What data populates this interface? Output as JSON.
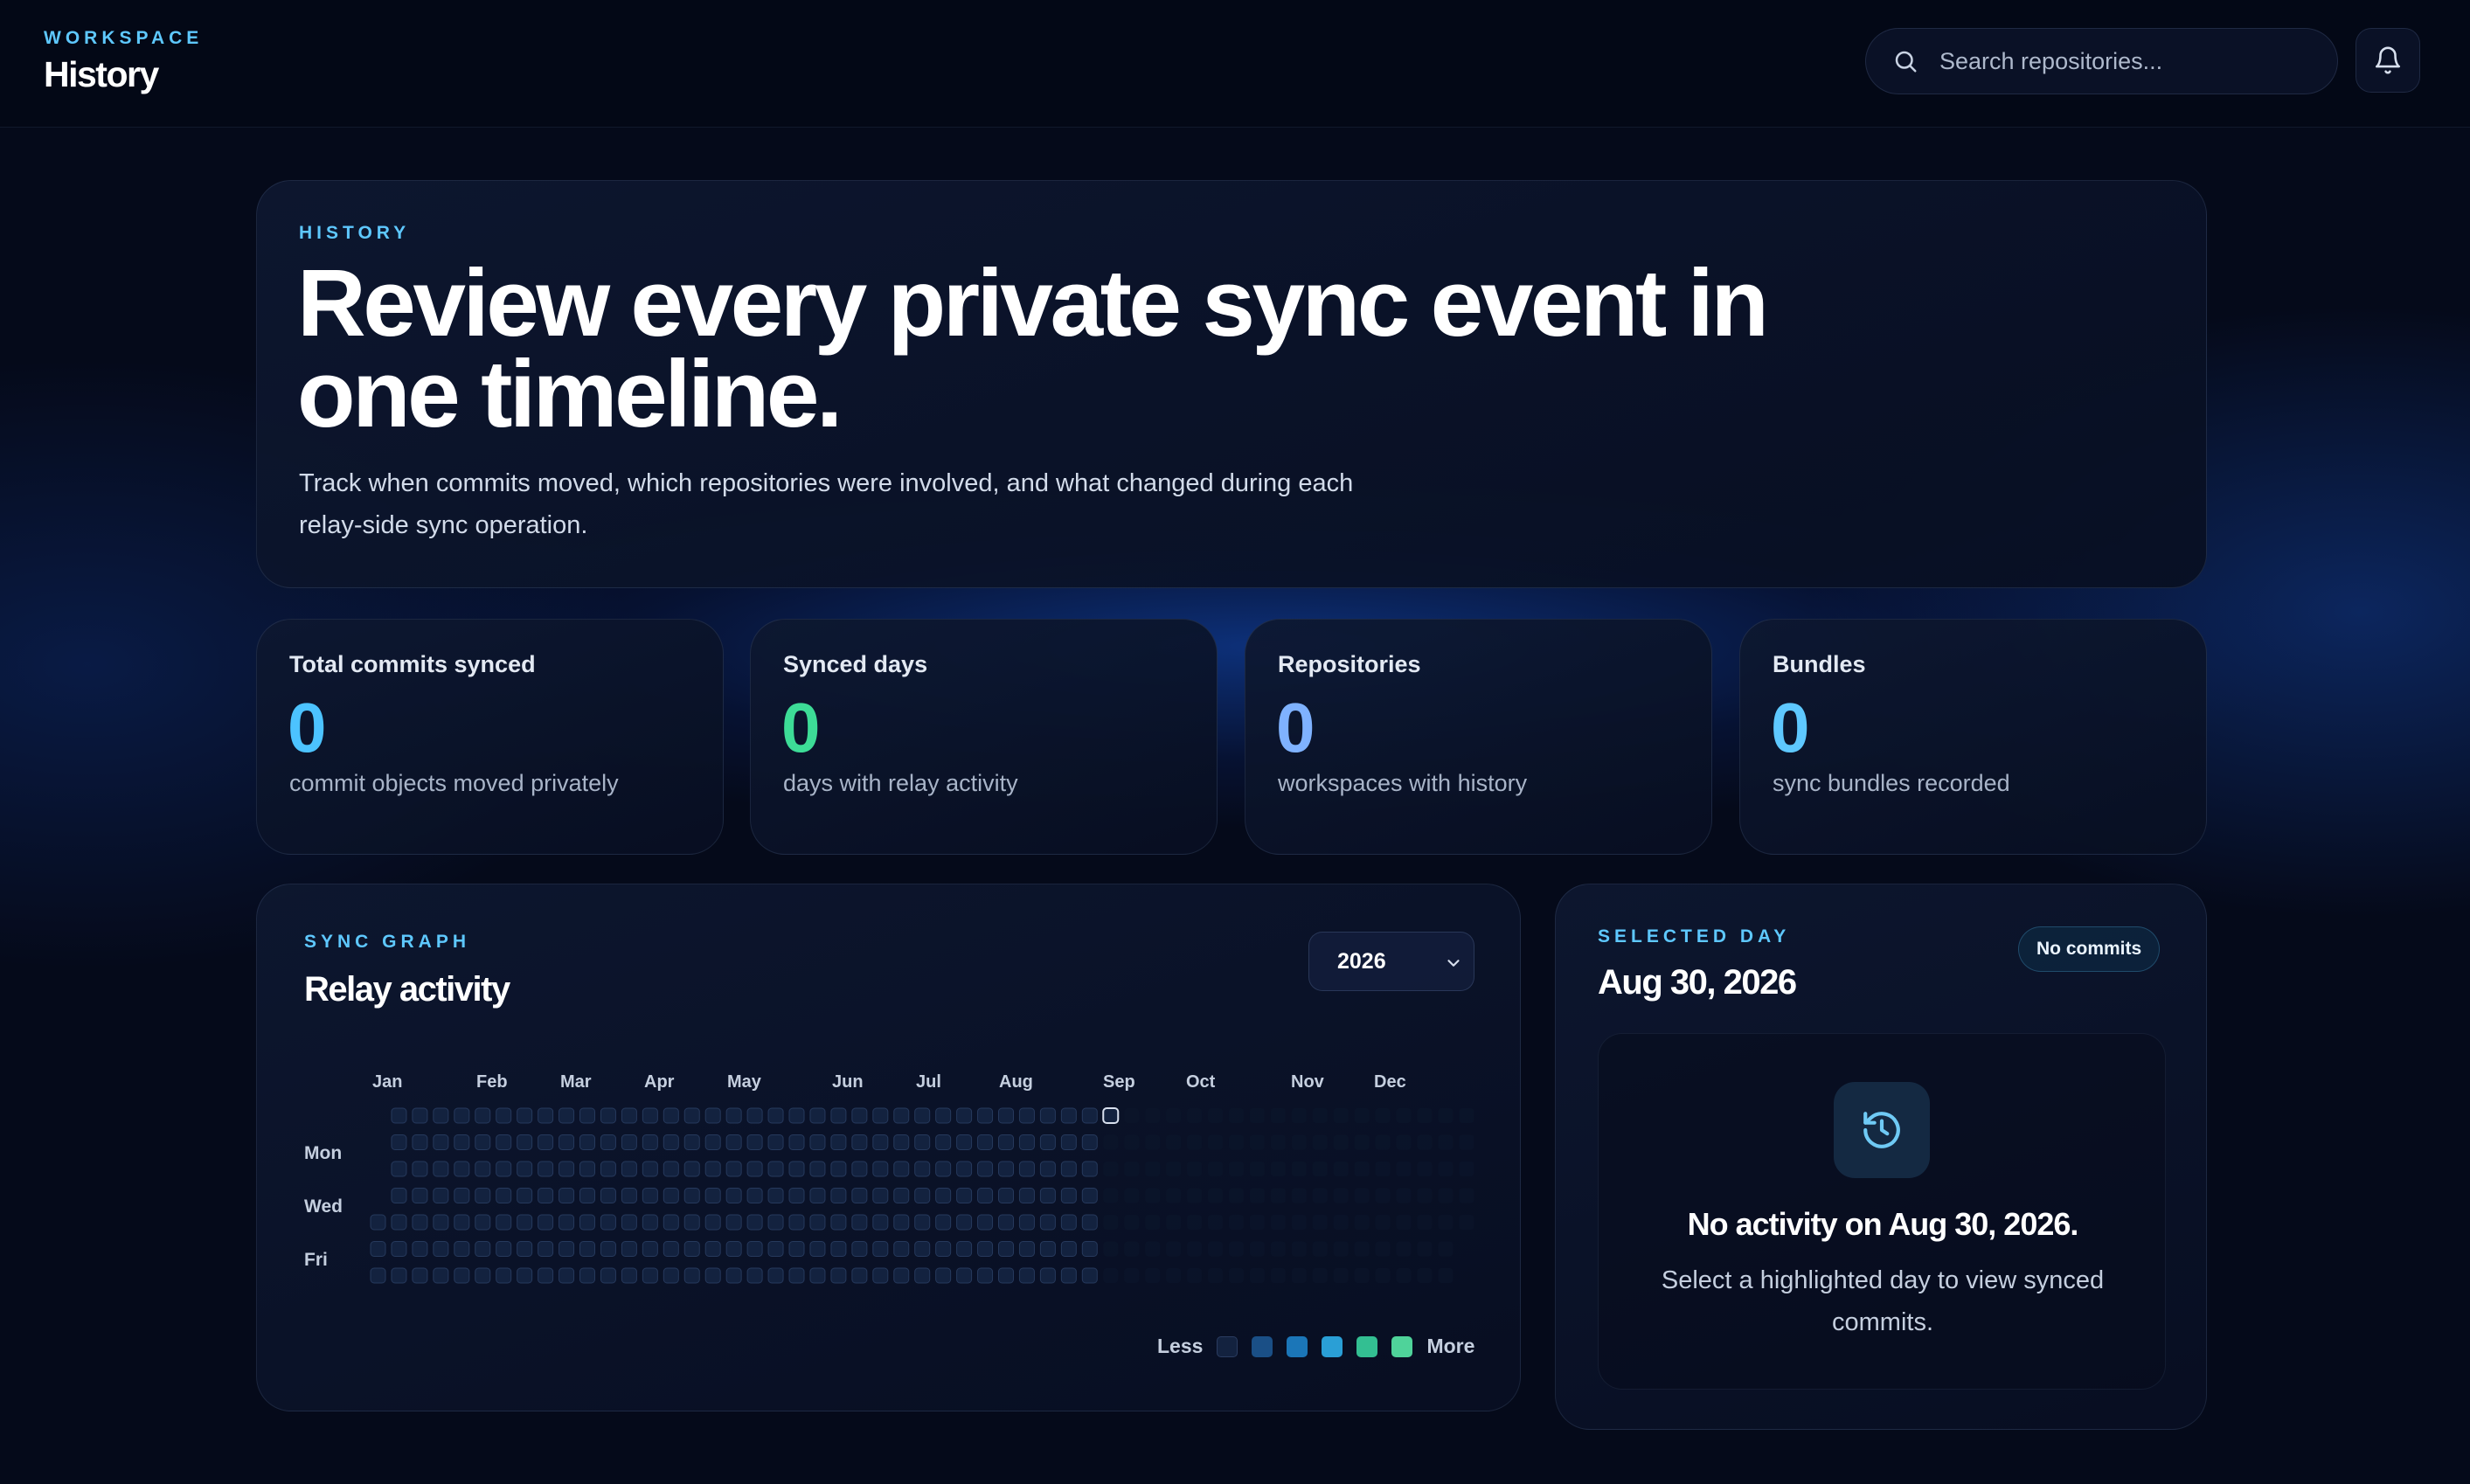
{
  "header": {
    "eyebrow": "WORKSPACE",
    "title": "History",
    "search_placeholder": "Search repositories..."
  },
  "hero": {
    "eyebrow": "HISTORY",
    "title": "Review every private sync event in one timeline.",
    "description": "Track when commits moved, which repositories were involved, and what changed during each relay-side sync operation."
  },
  "stats": [
    {
      "label": "Total commits synced",
      "value": "0",
      "sub": "commit objects moved privately",
      "color": "#4cc3ff"
    },
    {
      "label": "Synced days",
      "value": "0",
      "sub": "days with relay activity",
      "color": "#3ddc97"
    },
    {
      "label": "Repositories",
      "value": "0",
      "sub": "workspaces with history",
      "color": "#7fb2ff"
    },
    {
      "label": "Bundles",
      "value": "0",
      "sub": "sync bundles recorded",
      "color": "#5ec8ff"
    }
  ],
  "graph": {
    "eyebrow": "SYNC GRAPH",
    "title": "Relay activity",
    "year": "2026",
    "months": [
      "Jan",
      "Feb",
      "Mar",
      "Apr",
      "May",
      "Jun",
      "Jul",
      "Aug",
      "Sep",
      "Oct",
      "Nov",
      "Dec"
    ],
    "weekdays": [
      "Mon",
      "Wed",
      "Fri"
    ],
    "legend_less": "Less",
    "legend_more": "More",
    "legend_colors": [
      "#13223f",
      "#1a4f86",
      "#1b76b8",
      "#2a9fd6",
      "#33bf92",
      "#4fd39a"
    ]
  },
  "selected": {
    "eyebrow": "SELECTED DAY",
    "date": "Aug 30, 2026",
    "badge": "No commits",
    "empty_title": "No activity on Aug 30, 2026.",
    "empty_desc": "Select a highlighted day to view synced commits."
  }
}
